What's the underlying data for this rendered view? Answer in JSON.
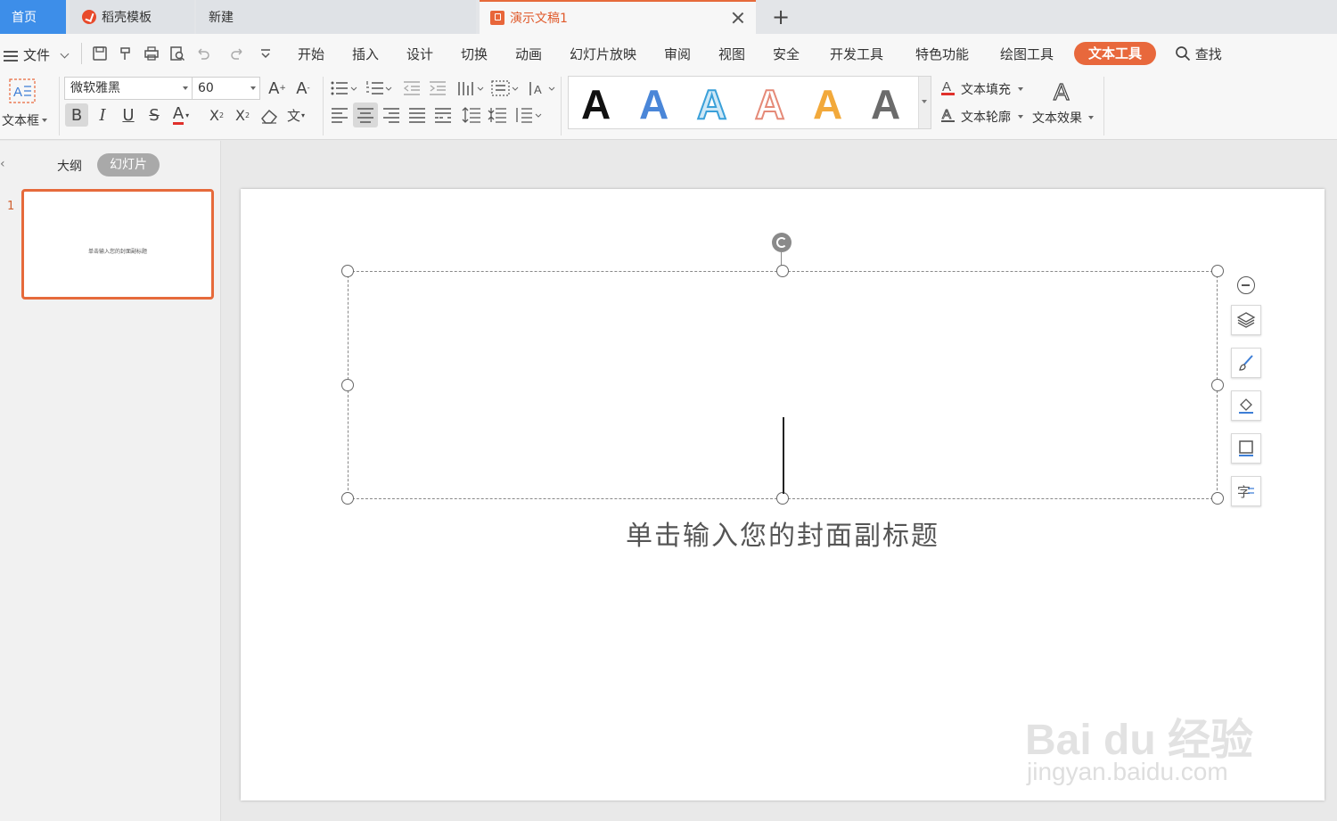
{
  "tabs": {
    "home": "首页",
    "daoke": "稻壳模板",
    "new": "新建",
    "doc": "演示文稿1",
    "plus": "+"
  },
  "menu": {
    "file": "文件",
    "items": [
      "开始",
      "插入",
      "设计",
      "切换",
      "动画",
      "幻灯片放映",
      "审阅",
      "视图",
      "安全",
      "开发工具",
      "特色功能",
      "绘图工具"
    ],
    "active": "文本工具",
    "search": "查找"
  },
  "ribbon": {
    "textbox": "文本框",
    "font_name": "微软雅黑",
    "font_size": "60",
    "text_fill": "文本填充",
    "text_outline": "文本轮廓",
    "text_effect": "文本效果",
    "style_letter": "A"
  },
  "left_panel": {
    "outline_tab": "大纲",
    "slides_tab": "幻灯片",
    "slide_number": "1",
    "thumb_text": "单击输入您的封面副标题"
  },
  "slide": {
    "subtitle": "单击输入您的封面副标题"
  },
  "watermark": {
    "line1": "Bai du 经验",
    "line2": "jingyan.baidu.com"
  },
  "colors": {
    "accent": "#e8683c",
    "home_tab": "#3d8ee9"
  }
}
